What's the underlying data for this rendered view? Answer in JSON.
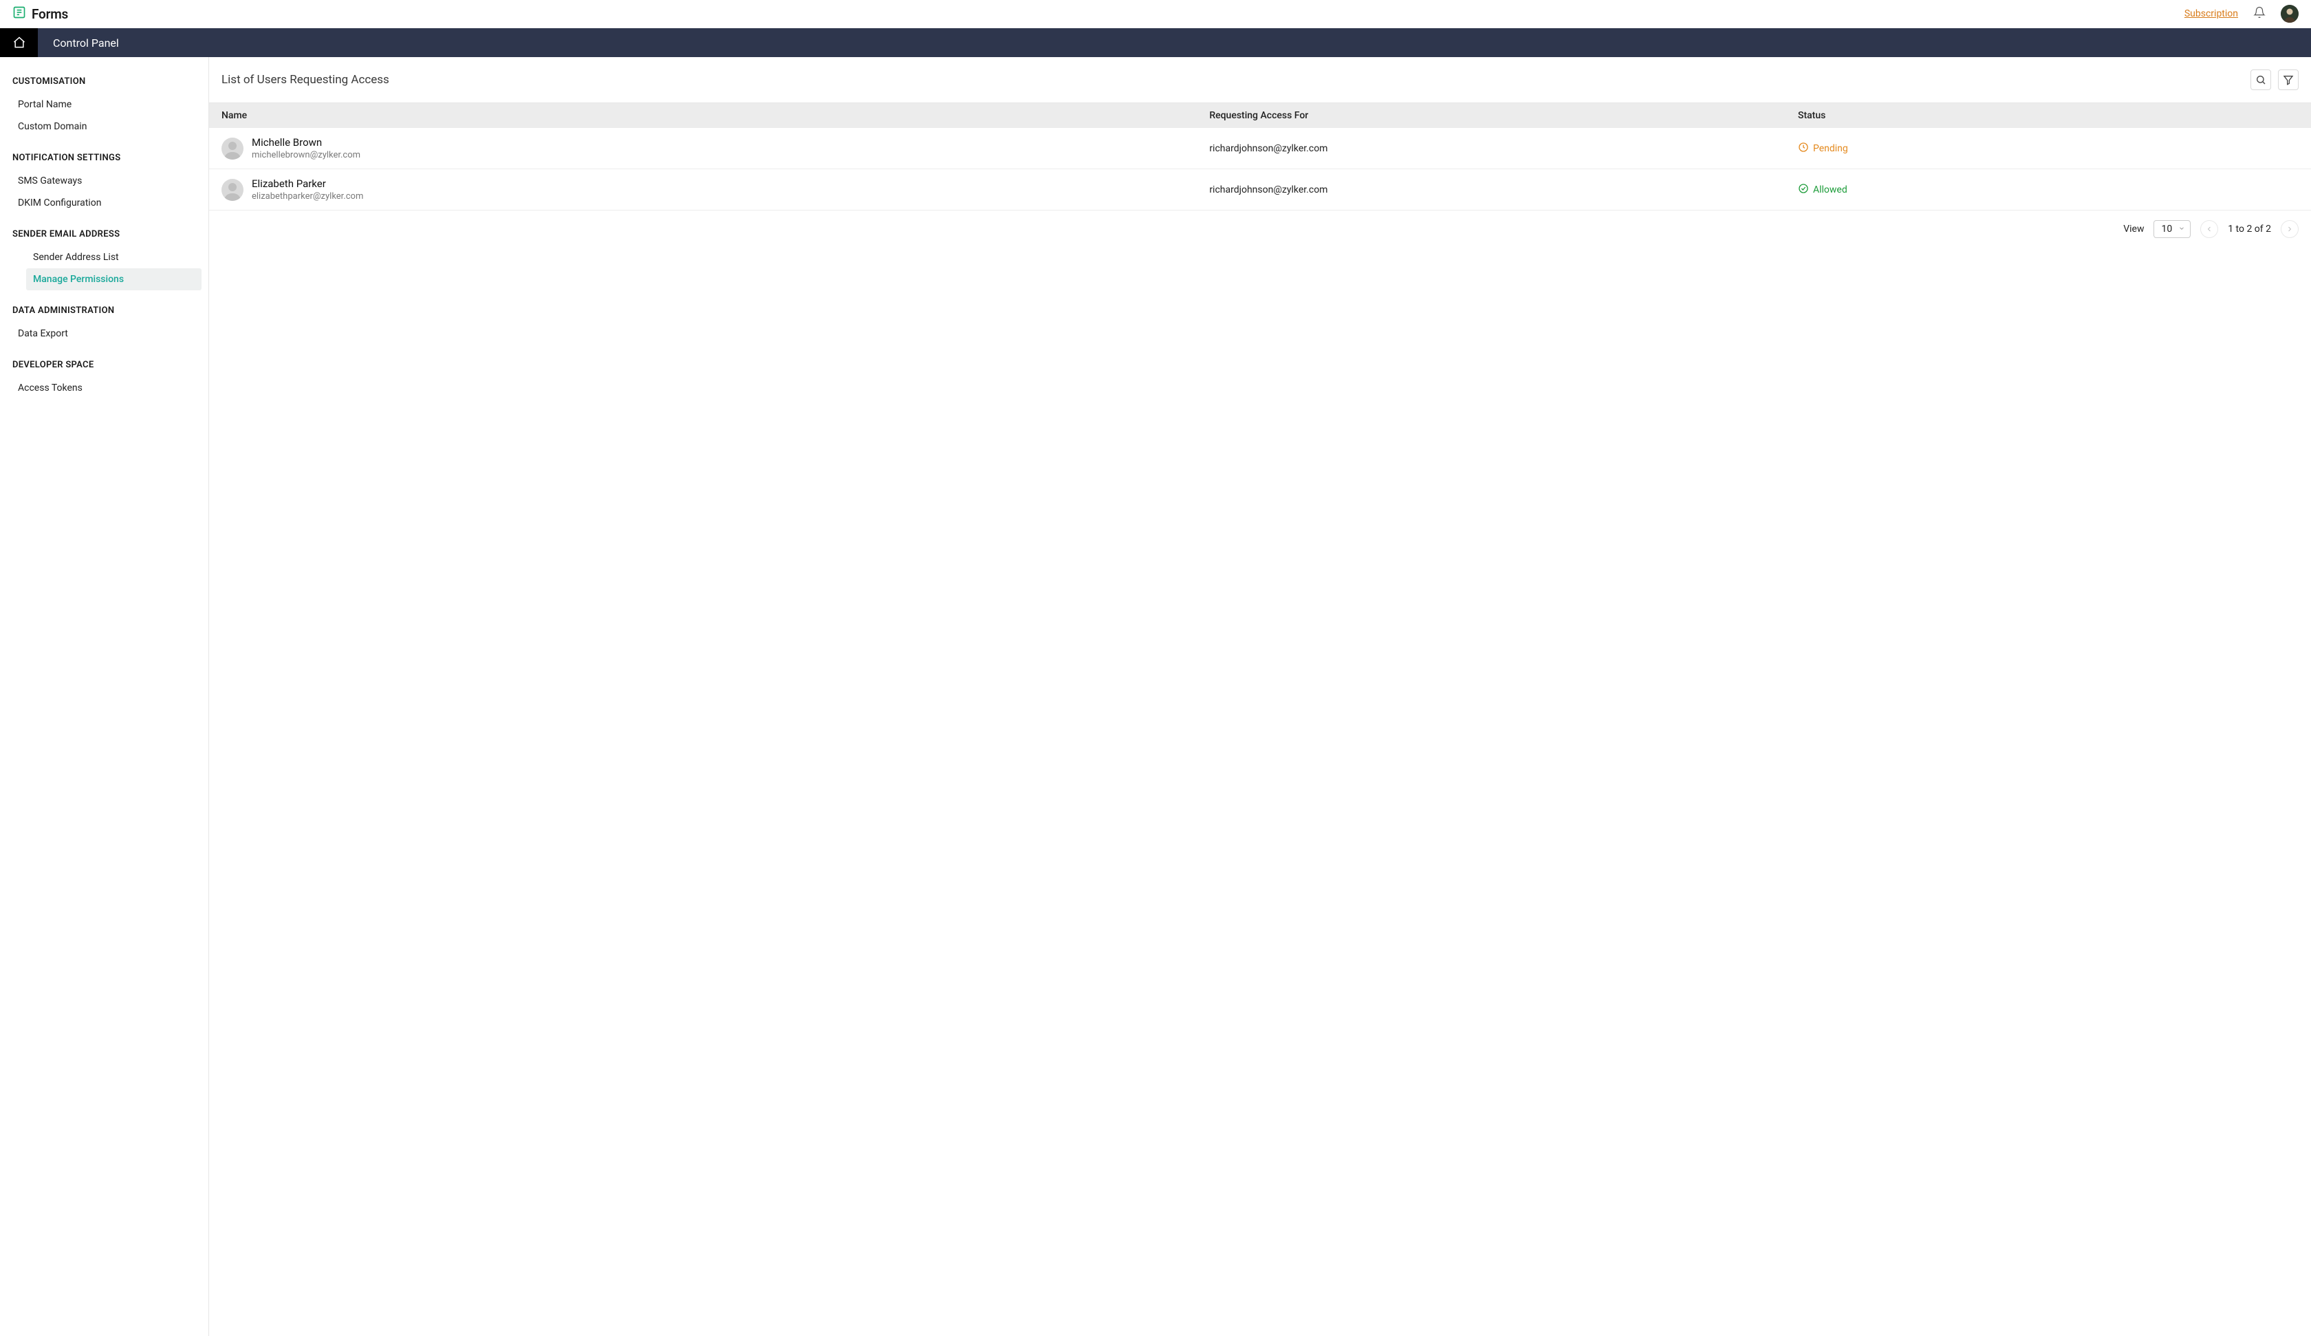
{
  "topbar": {
    "brand": "Forms",
    "subscription": "Subscription"
  },
  "header": {
    "title": "Control Panel"
  },
  "sidebar": {
    "sections": [
      {
        "title": "CUSTOMISATION",
        "items": [
          {
            "label": "Portal Name"
          },
          {
            "label": "Custom Domain"
          }
        ]
      },
      {
        "title": "NOTIFICATION SETTINGS",
        "items": [
          {
            "label": "SMS Gateways"
          },
          {
            "label": "DKIM Configuration"
          }
        ]
      },
      {
        "title": "SENDER EMAIL ADDRESS",
        "nested": true,
        "items": [
          {
            "label": "Sender Address List"
          },
          {
            "label": "Manage Permissions",
            "active": true
          }
        ]
      },
      {
        "title": "DATA ADMINISTRATION",
        "items": [
          {
            "label": "Data Export"
          }
        ]
      },
      {
        "title": "DEVELOPER SPACE",
        "items": [
          {
            "label": "Access Tokens"
          }
        ]
      }
    ]
  },
  "main": {
    "title": "List of Users Requesting Access",
    "columns": {
      "name": "Name",
      "requesting": "Requesting Access For",
      "status": "Status"
    },
    "rows": [
      {
        "name": "Michelle Brown",
        "email": "michellebrown@zylker.com",
        "requesting": "richardjohnson@zylker.com",
        "status": "Pending",
        "status_kind": "pending"
      },
      {
        "name": "Elizabeth Parker",
        "email": "elizabethparker@zylker.com",
        "requesting": "richardjohnson@zylker.com",
        "status": "Allowed",
        "status_kind": "allowed"
      }
    ],
    "footer": {
      "view_label": "View",
      "page_size": "10",
      "range": "1 to 2 of 2"
    }
  }
}
